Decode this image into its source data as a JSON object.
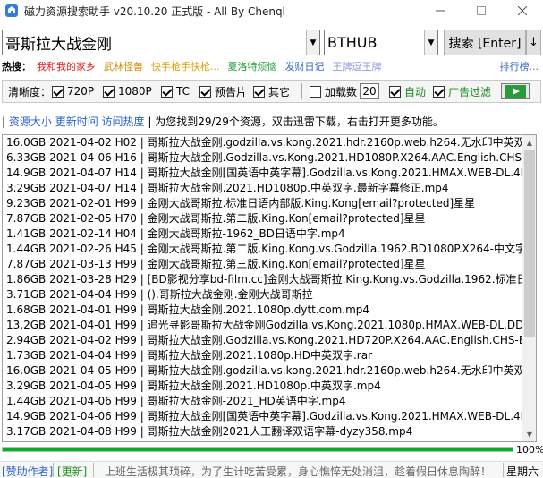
{
  "window": {
    "title": "磁力资源搜索助手 v20.10.20 正式版 - All By Chenql",
    "minimize_icon": "minimize-icon",
    "maximize_icon": "maximize-icon",
    "close_icon": "close-icon"
  },
  "search": {
    "query": "哥斯拉大战金刚",
    "engine": "BTHUB",
    "button_label": "搜索 [Enter]",
    "split_label": "↓"
  },
  "hot": {
    "label": "热搜：",
    "items": [
      {
        "text": "我和我的家乡",
        "color": "#e02020"
      },
      {
        "text": "武林怪兽",
        "color": "#d08a00"
      },
      {
        "text": "快手枪手快枪...",
        "color": "#e0a000"
      },
      {
        "text": "夏洛特烦恼",
        "color": "#1f9e3c"
      },
      {
        "text": "发财日记",
        "color": "#3e68c4"
      },
      {
        "text": "王牌逗王牌",
        "color": "#8c9be0"
      }
    ],
    "more": "排行榜..."
  },
  "options": {
    "clarity_label": "清晰度：",
    "clarity": [
      {
        "label": "720P",
        "checked": true
      },
      {
        "label": "1080P",
        "checked": true
      },
      {
        "label": "TC",
        "checked": true
      },
      {
        "label": "预告片",
        "checked": true
      },
      {
        "label": "其它",
        "checked": true
      }
    ],
    "load_label": "加载数",
    "load_checked": false,
    "load_count": "20",
    "auto_label": "自动",
    "auto_checked": true,
    "adfilter_label": "广告过滤",
    "adfilter_checked": true
  },
  "info": {
    "size_link": "资源大小",
    "time_link": "更新时间",
    "heat_link": "访问热度",
    "message": "| 为您找到29/29个资源，双击迅雷下载，右击打开更多功能。"
  },
  "results": [
    "16.0GB 2021-04-02 H02 | 哥斯拉大战金刚.godzilla.vs.kong.2021.hdr.2160p.web.h264.无水印中英双字.mp4",
    "6.33GB 2021-04-06 H16 | 哥斯拉大战金刚.Godzilla.vs.Kong.2021.HD1080P.X264.AAC.English.CHS-ENG.mp4",
    "14.9GB 2021-04-07 H14 | 哥斯拉大战金刚[国英语中英字幕].Godzilla.vs.Kong.2021.HMAX.WEB-DL.4K.HEVC.mkv",
    "3.29GB 2021-04-07 H14 | 哥斯拉大战金刚.2021.HD1080p.中英双字.最新字幕修正.mp4",
    "9.23GB 2021-02-01 H99 | 金刚大战哥斯拉.标准日语内部版.King.Kong[email?protected]星星",
    "7.87GB 2021-02-05 H70 | 金刚大战哥斯拉.第二版.King.Kon[email?protected]星星",
    "1.41GB 2021-02-14 H04 | 金刚大战哥斯拉-1962_BD日语中字.mp4",
    "1.44GB 2021-02-26 H45 | 金刚大战哥斯拉.第二版.King.Kong.vs.Godzilla.1962.BD1080P.X264-中文字幕.mkv",
    "7.87GB 2021-03-13 H99 | 金刚大战哥斯拉.第三版.King.Kon[email?protected]星星",
    "1.86GB 2021-03-28 H29 | [BD影视分享bd-film.cc]金刚大战哥斯拉.King.Kong.vs.Godzilla.1962.标准日语.mkv",
    "3.71GB 2021-04-04 H99 | ().哥斯拉大战金刚.金刚大战哥斯拉",
    "1.68GB 2021-04-01 H99 | 哥斯拉大战金刚.2021.1080p.dytt.com.mp4",
    "13.2GB 2021-04-01 H99 | 追光寻影哥斯拉大战金刚Godzilla.vs.Kong.2021.1080p.HMAX.WEB-DL.DDP5.1.Atmos",
    "2.94GB 2021-04-02 H99 | 哥斯拉大战金刚.Godzilla.vs.Kong.2021.HD720P.X264.AAC.English.CHS-ENG.mp4",
    "1.73GB 2021-04-04 H99 | 哥斯拉大战金刚.2021.1080p.HD中英双字.rar",
    "16.0GB 2021-04-05 H99 | 哥斯拉大战金刚.godzilla.vs.kong.2021.hdr.2160p.web.h264.无水印中英双字.mp4",
    "3.29GB 2021-04-05 H99 | 哥斯拉大战金刚.2021.HD1080p.中英双字.mp4",
    "1.44GB 2021-04-06 H99 | 哥斯拉大战金刚-2021_HD英语中字.mp4",
    "14.9GB 2021-04-06 H99 | 哥斯拉大战金刚[国英语中英字幕].Godzilla.vs.Kong.2021.HMAX.WEB-DL.4K.HEVC.mkv",
    "3.17GB 2021-04-08 H99 | 哥斯拉大战金刚2021人工翻译双语字幕-dyzy358.mp4"
  ],
  "progress": {
    "value": 1.0,
    "label": "100%",
    "color": "#06b025"
  },
  "status": {
    "sponsor": "[赞助作者]",
    "update": "[更新]",
    "message": "上班生活极其琐碎，为了生计吃苦受累，身心憔悴无处消沮，趁着假日休息陶醉！",
    "day": "星期六"
  }
}
